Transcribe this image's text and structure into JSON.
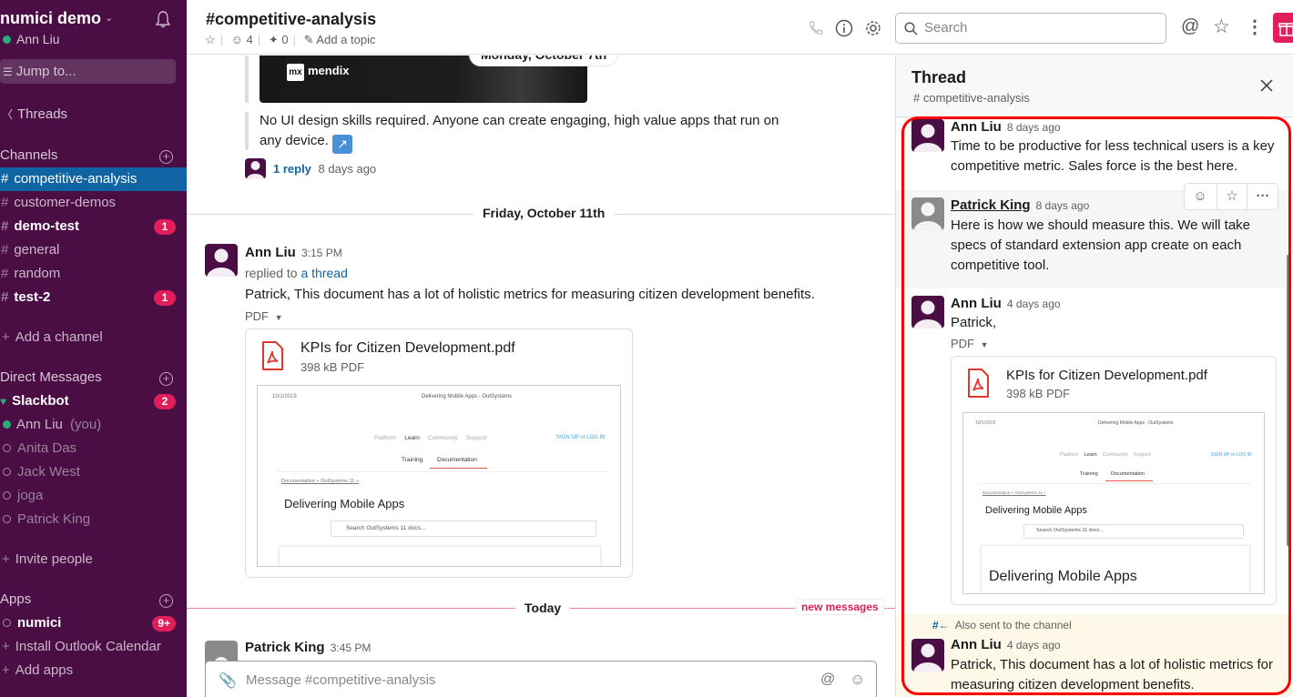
{
  "workspace": {
    "name": "numici demo",
    "user": "Ann Liu"
  },
  "sidebar": {
    "jump_to": "Jump to...",
    "threads": "Threads",
    "channels_header": "Channels",
    "channels": [
      {
        "name": "competitive-analysis",
        "active": true
      },
      {
        "name": "customer-demos"
      },
      {
        "name": "demo-test",
        "unread": true,
        "badge": "1"
      },
      {
        "name": "general"
      },
      {
        "name": "random"
      },
      {
        "name": "test-2",
        "unread": true,
        "badge": "1"
      }
    ],
    "add_channel": "Add a channel",
    "dm_header": "Direct Messages",
    "dms": [
      {
        "name": "Slackbot",
        "badge": "2"
      },
      {
        "name": "Ann Liu",
        "suffix": "(you)"
      },
      {
        "name": "Anita Das"
      },
      {
        "name": "Jack West"
      },
      {
        "name": "joga"
      },
      {
        "name": "Patrick King"
      }
    ],
    "invite": "Invite people",
    "apps_header": "Apps",
    "apps": [
      {
        "name": "numici",
        "badge": "9+"
      }
    ],
    "install_outlook": "Install Outlook Calendar",
    "add_apps": "Add apps"
  },
  "header": {
    "channel_title": "#competitive-analysis",
    "members": "4",
    "pins": "0",
    "add_topic": "Add a topic",
    "search_placeholder": "Search"
  },
  "main": {
    "date_monday": "Monday, October 7th",
    "mendix_logo": "mx",
    "mendix_word": "mendix",
    "quote_text": "No UI design skills required. Anyone can create engaging, high value apps that run on any device.",
    "reply_count": "1 reply",
    "reply_time": "8 days ago",
    "date_friday": "Friday, October 11th",
    "msg1": {
      "author": "Ann Liu",
      "time": "3:15 PM",
      "replied_prefix": "replied to",
      "replied_link": "a thread",
      "text": "Patrick, This document has a lot of holistic metrics for measuring citizen development benefits.",
      "file_type_label": "PDF",
      "file_name": "KPIs for Citizen Development.pdf",
      "file_size": "398 kB PDF"
    },
    "preview": {
      "date": "10/1/2019",
      "page_title": "Delivering Mobile Apps - OutSystems",
      "nav": [
        "Platform",
        "Learn",
        "Community",
        "Support"
      ],
      "signup": "SIGN UP or LOG IN",
      "tabs": [
        "Training",
        "Documentation"
      ],
      "crumbs": "Documentation  »  OutSystems 11  »",
      "heading": "Delivering Mobile Apps",
      "search": "Search OutSystems 11 docs..."
    },
    "date_today": "Today",
    "new_messages": "new messages",
    "msg2": {
      "author": "Patrick King",
      "time": "3:45 PM"
    },
    "composer_placeholder": "Message #competitive-analysis"
  },
  "thread": {
    "title": "Thread",
    "channel": "# competitive-analysis",
    "messages": [
      {
        "author": "Ann Liu",
        "time": "8 days ago",
        "text": "Time to be productive for less technical users is a key competitive metric. Sales force is the best here."
      },
      {
        "author": "Patrick King",
        "time": "8 days ago",
        "text": "Here is how we should measure this. We will take specs of standard extension app create on each competitive tool."
      },
      {
        "author": "Ann Liu",
        "time": "4 days ago",
        "text": "Patrick,",
        "file_type_label": "PDF",
        "file_name": "KPIs for Citizen Development.pdf",
        "file_size": "398 kB PDF",
        "preview_big_heading": "Delivering Mobile Apps"
      },
      {
        "also_sent": "Also sent to the channel",
        "author": "Ann Liu",
        "time": "4 days ago",
        "text": "Patrick, This document has a lot of holistic metrics for measuring citizen development benefits."
      }
    ]
  }
}
